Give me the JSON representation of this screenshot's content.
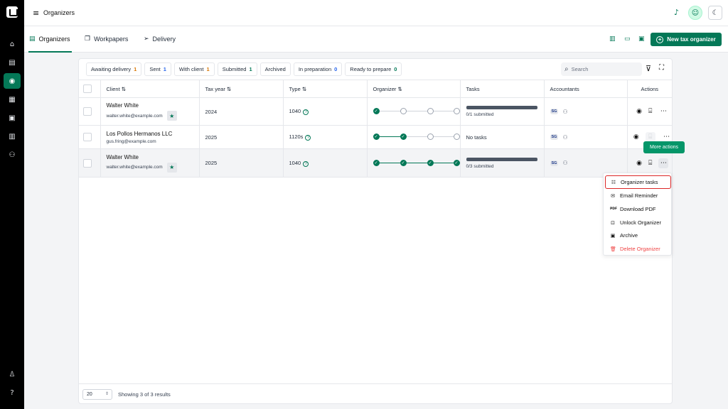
{
  "app": {
    "title": "Organizers"
  },
  "tabs": [
    {
      "label": "Organizers",
      "icon": "clipboard-icon"
    },
    {
      "label": "Workpapers",
      "icon": "copy-icon"
    },
    {
      "label": "Delivery",
      "icon": "send-icon"
    }
  ],
  "toolbar": {
    "new_button_label": "New tax organizer"
  },
  "filters": [
    {
      "label": "Awaiting delivery",
      "count": "1",
      "color": "#d97706"
    },
    {
      "label": "Sent",
      "count": "1",
      "color": "#2563eb"
    },
    {
      "label": "With client",
      "count": "1",
      "color": "#d97706"
    },
    {
      "label": "Submitted",
      "count": "1",
      "color": "#047857"
    },
    {
      "label": "Archived",
      "count": "",
      "color": "#6b7280"
    },
    {
      "label": "In preparation",
      "count": "0",
      "color": "#2563eb"
    },
    {
      "label": "Ready to prepare",
      "count": "0",
      "color": "#047857"
    }
  ],
  "search": {
    "placeholder": "Search"
  },
  "table": {
    "headers": {
      "client": "Client ⇅",
      "tax_year": "Tax year ⇅",
      "type": "Type ⇅",
      "organizer": "Organizer ⇅",
      "tasks": "Tasks",
      "accountants": "Accountants",
      "actions": "Actions"
    },
    "rows": [
      {
        "name": "Walter White",
        "email": "walter.white@example.com",
        "starred": true,
        "tax_year": "2024",
        "type": "1040",
        "progress_steps_done": 1,
        "progress_steps_total": 4,
        "tasks_text": "0/1 submitted",
        "has_task_bar": true,
        "accountant": "SG"
      },
      {
        "name": "Los Pollos Hermanos LLC",
        "email": "gus.fring@example.com",
        "starred": false,
        "tax_year": "2025",
        "type": "1120s",
        "progress_steps_done": 2,
        "progress_steps_total": 4,
        "tasks_text": "No tasks",
        "has_task_bar": false,
        "accountant": "SG"
      },
      {
        "name": "Walter White",
        "email": "walter.white@example.com",
        "starred": true,
        "tax_year": "2025",
        "type": "1040",
        "progress_steps_done": 4,
        "progress_steps_total": 4,
        "tasks_text": "0/3 submitted",
        "has_task_bar": true,
        "accountant": "SG"
      }
    ]
  },
  "tooltip": {
    "text": "More actions"
  },
  "context_menu": {
    "items": [
      {
        "label": "Organizer tasks",
        "icon": "list-icon"
      },
      {
        "label": "Email Reminder",
        "icon": "mail-icon"
      },
      {
        "label": "Download PDF",
        "icon": "pdf-icon"
      },
      {
        "label": "Unlock Organizer",
        "icon": "unlock-icon"
      },
      {
        "label": "Archive",
        "icon": "archive-icon"
      },
      {
        "label": "Delete Organizer",
        "icon": "trash-icon"
      }
    ]
  },
  "pagination": {
    "page_size": "20",
    "showing": "Showing 3 of 3 results"
  },
  "colors": {
    "accent": "#047857",
    "danger": "#ef4444"
  }
}
